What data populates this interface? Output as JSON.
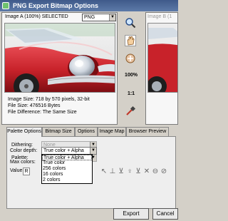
{
  "window": {
    "title": "PNG Export Bitmap Options"
  },
  "panel_a": {
    "header": "Image A (100%) SELECTED",
    "format": "PNG",
    "info": [
      "Image Size: 718 by 570 pixels, 32-bit",
      "File Size: 476516 Bytes",
      "File Difference: The Same Size"
    ]
  },
  "panel_b": {
    "header": "Image B (1"
  },
  "tools": {
    "zoom_label": "100%",
    "actual_label": "1:1"
  },
  "tabs": [
    "Palette Options",
    "Bitmap Size",
    "Options",
    "Image Map",
    "Browser Preview"
  ],
  "palette": {
    "dithering_label": "Dithering:",
    "dithering_value": "None",
    "palette_label": "Palette:",
    "palette_value": "",
    "color_depth_label": "Color depth:",
    "color_depth_value": "True color + Alpha",
    "max_colors_label": "Max colors:",
    "value_label": "Value:",
    "value_value": "R",
    "color_depth_options": [
      "True color + Alpha",
      "True color",
      "256 colors",
      "16 colors",
      "2 colors"
    ]
  },
  "buttons": {
    "export": "Export",
    "cancel": "Cancel"
  },
  "colors": {
    "car_red": "#c8222a",
    "titlebar": "#4a679a"
  }
}
